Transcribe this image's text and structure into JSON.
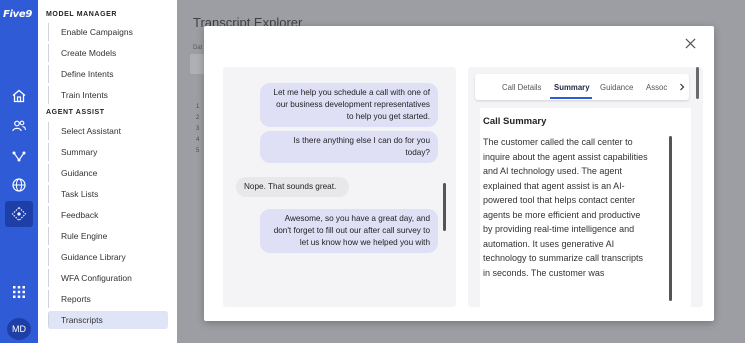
{
  "brand": {
    "logo_text": "Five9"
  },
  "rail": {
    "icons": [
      "home-icon",
      "users-icon",
      "routing-icon",
      "globe-icon",
      "agent-assist-icon",
      "apps-grid-icon"
    ],
    "avatar_initials": "MD"
  },
  "nav": {
    "section_model_manager": "MODEL MANAGER",
    "model_items": [
      "Enable Campaigns",
      "Create Models",
      "Define Intents",
      "Train Intents"
    ],
    "section_agent_assist": "AGENT ASSIST",
    "agent_items": [
      "Select Assistant",
      "Summary",
      "Guidance",
      "Task Lists",
      "Feedback",
      "Rule Engine",
      "Guidance Library",
      "WFA Configuration",
      "Reports",
      "Transcripts"
    ],
    "selected": "Transcripts"
  },
  "background": {
    "title": "Transcript Explorer",
    "small_label": "Dat",
    "row_numbers": [
      "1",
      "2",
      "3",
      "4",
      "5"
    ]
  },
  "transcript": {
    "messages": [
      {
        "speaker": "agent",
        "text": "Let me help you schedule a call with one of our business development representatives to help you get started."
      },
      {
        "speaker": "agent",
        "text": "Is there anything else I can do for you today?"
      },
      {
        "speaker": "customer",
        "text": "Nope. That sounds great."
      },
      {
        "speaker": "agent",
        "text": "Awesome, so you have a great day, and don't forget to fill out our after call survey to let us know how we helped you with"
      }
    ]
  },
  "details": {
    "tabs": [
      "Call Details",
      "Summary",
      "Guidance",
      "Assoc"
    ],
    "active_tab": "Summary",
    "summary_title": "Call Summary",
    "summary_text": "The customer called the call center to inquire about the agent assist capabilities and AI technology used. The agent explained that agent assist is an AI-powered tool that helps contact center agents be more efficient and productive by providing real-time intelligence and automation. It uses generative AI technology to summarize call transcripts in seconds. The customer was"
  },
  "colors": {
    "rail": "#2f5bd6",
    "accent": "#2f5bd6",
    "agent_bubble": "#dfe0f6",
    "customer_bubble": "#e8e8eb",
    "overlay": "#9c9ea3"
  }
}
